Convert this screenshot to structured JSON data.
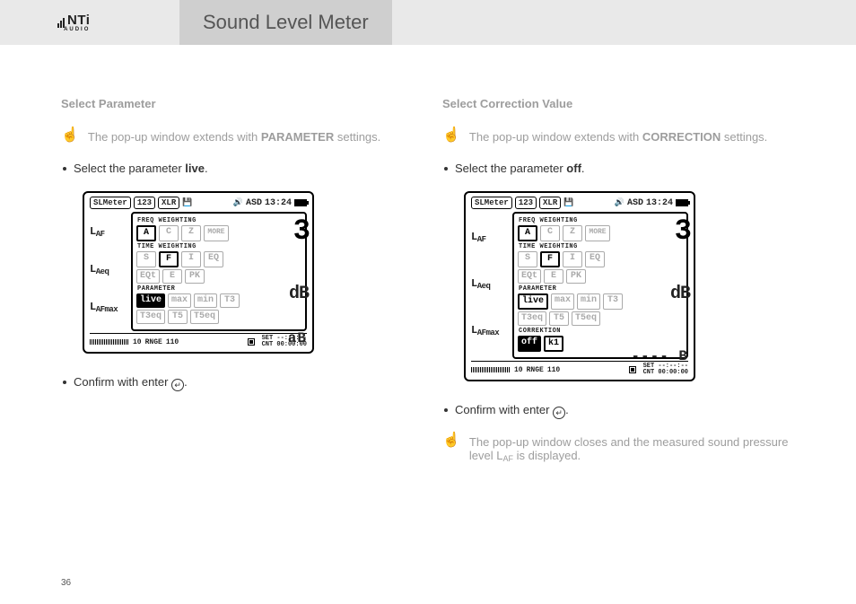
{
  "page_number": "36",
  "header": {
    "logo_main": "NTi",
    "logo_sub": "AUDIO",
    "title": "Sound Level Meter"
  },
  "left": {
    "heading": "Select Parameter",
    "result1_a": "The pop-up window extends with ",
    "result1_b": "PARAMETER",
    "result1_c": " settings.",
    "bullet1_a": "Select the parameter ",
    "bullet1_b": "live",
    "bullet1_c": ".",
    "bullet2_a": "Confirm with enter ",
    "bullet2_b": "."
  },
  "right": {
    "heading": "Select Correction Value",
    "result1_a": "The pop-up window extends with ",
    "result1_b": "CORRECTION",
    "result1_c": " settings.",
    "bullet1_a": "Select the parameter ",
    "bullet1_b": "off",
    "bullet1_c": ".",
    "bullet2_a": "Confirm with enter ",
    "bullet2_b": ".",
    "result2": "The pop-up window closes and the measured sound pressure level L",
    "result2_sub": "AF",
    "result2_end": " is displayed."
  },
  "device_common": {
    "top_tab1": "SLMeter",
    "top_tab2": "123",
    "top_tab3": "XLR",
    "asd": "ASD",
    "time": "13:24",
    "label_laf": "L",
    "label_laf_sub": "AF",
    "label_laeq": "L",
    "label_laeq_sub": "Aeq",
    "label_lafmax": "L",
    "label_lafmax_sub": "AFmax",
    "sec_freq": "FREQ WEIGHTING",
    "sec_time": "TIME WEIGHTING",
    "sec_param": "PARAMETER",
    "sec_corr": "CORREKTION",
    "fw": [
      "A",
      "C",
      "Z",
      "MORE"
    ],
    "tw1": [
      "S",
      "F",
      "I",
      "EQ"
    ],
    "tw2": [
      "EQt",
      "E",
      "PK"
    ],
    "param": [
      "live",
      "max",
      "min",
      "T3"
    ],
    "param2": [
      "T3eq",
      "T5",
      "T5eq"
    ],
    "corr": [
      "off",
      "k1"
    ],
    "big3": "3",
    "db": "dB",
    "abB": "aB",
    "dashdb": "---- B",
    "rnge_lo": "10",
    "rnge": "RNGE",
    "rnge_hi": "110",
    "set": "SET --:--:--",
    "cnt": "CNT 00:00:00"
  }
}
